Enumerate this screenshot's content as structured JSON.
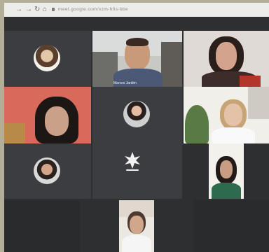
{
  "browser": {
    "url": "meet.google.com/xzm-hfis-bbe"
  },
  "participants": [
    {
      "id": "p1",
      "name": ""
    },
    {
      "id": "p2",
      "name": "Marcos Jardim"
    },
    {
      "id": "p3",
      "name": ""
    },
    {
      "id": "p4",
      "name": ""
    },
    {
      "id": "p5",
      "name": ""
    },
    {
      "id": "p6",
      "name": ""
    },
    {
      "id": "p7",
      "name": ""
    },
    {
      "id": "p8",
      "name": ""
    },
    {
      "id": "p9",
      "name": ""
    },
    {
      "id": "p10",
      "name": ""
    },
    {
      "id": "p11",
      "name": ""
    }
  ],
  "icons": {
    "back": "arrow-right-icon",
    "forward": "arrow-right-icon",
    "reload": "reload-icon",
    "home": "home-icon",
    "lock": "lock-icon"
  },
  "colors": {
    "speaking_indicator": "#1a73e8",
    "tile_bg": "#3b3d40",
    "stage_bg": "#2d2f31"
  }
}
